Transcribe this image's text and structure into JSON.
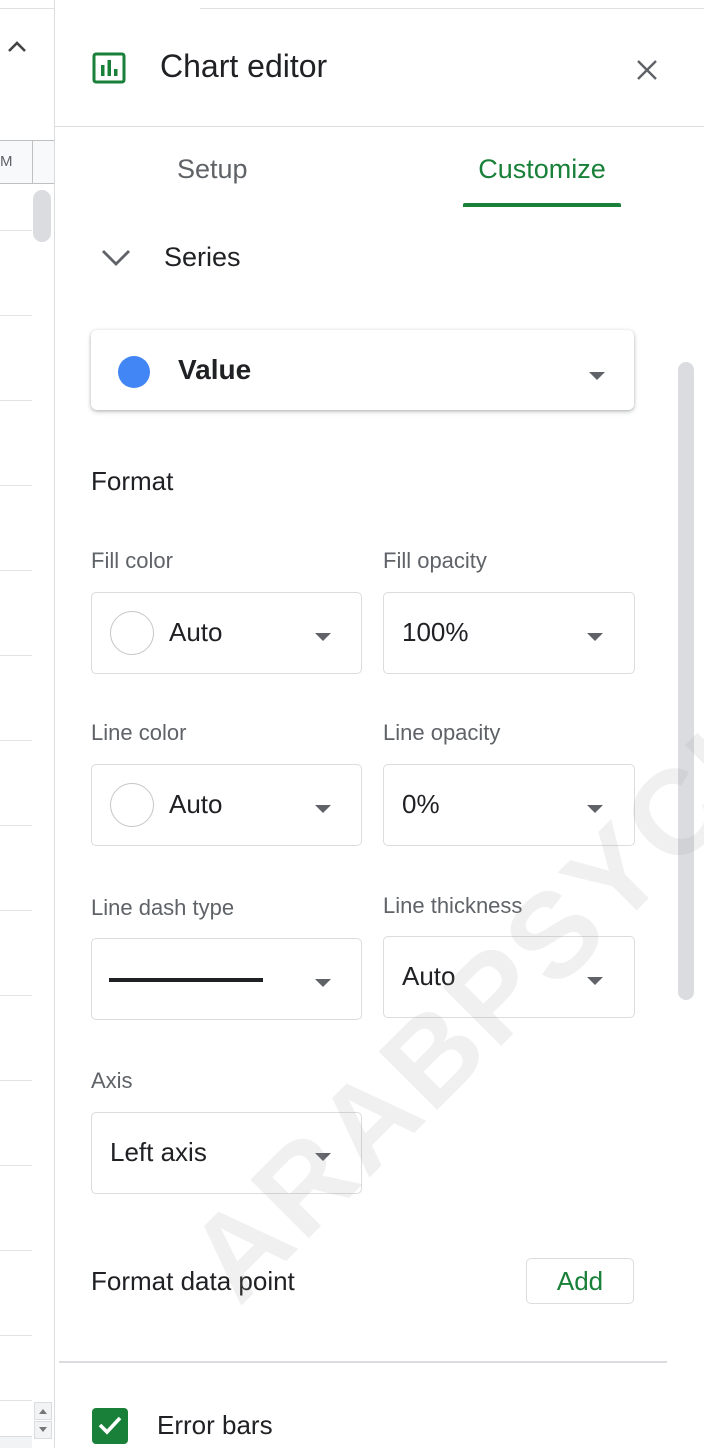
{
  "sheet": {
    "column_letter": "M"
  },
  "editor": {
    "title": "Chart editor",
    "tabs": [
      {
        "label": "Setup",
        "active": false
      },
      {
        "label": "Customize",
        "active": true
      }
    ],
    "accent_color": "#188038"
  },
  "series_section": {
    "title": "Series",
    "selected_series": "Value",
    "selected_series_color": "#4285f4"
  },
  "format": {
    "heading": "Format",
    "fill_color_label": "Fill color",
    "fill_color_value": "Auto",
    "fill_opacity_label": "Fill opacity",
    "fill_opacity_value": "100%",
    "line_color_label": "Line color",
    "line_color_value": "Auto",
    "line_opacity_label": "Line opacity",
    "line_opacity_value": "0%",
    "line_dash_label": "Line dash type",
    "line_thickness_label": "Line thickness",
    "line_thickness_value": "Auto",
    "axis_label": "Axis",
    "axis_value": "Left axis"
  },
  "format_data_point": {
    "heading": "Format data point",
    "add_label": "Add"
  },
  "error_bars": {
    "label": "Error bars",
    "checked": true
  },
  "watermark": "ARABPSYCHO",
  "icons": [
    "chevron-up-icon",
    "chart-icon",
    "close-icon",
    "chevron-down-icon",
    "caret-down-icon",
    "checkmark-icon"
  ]
}
